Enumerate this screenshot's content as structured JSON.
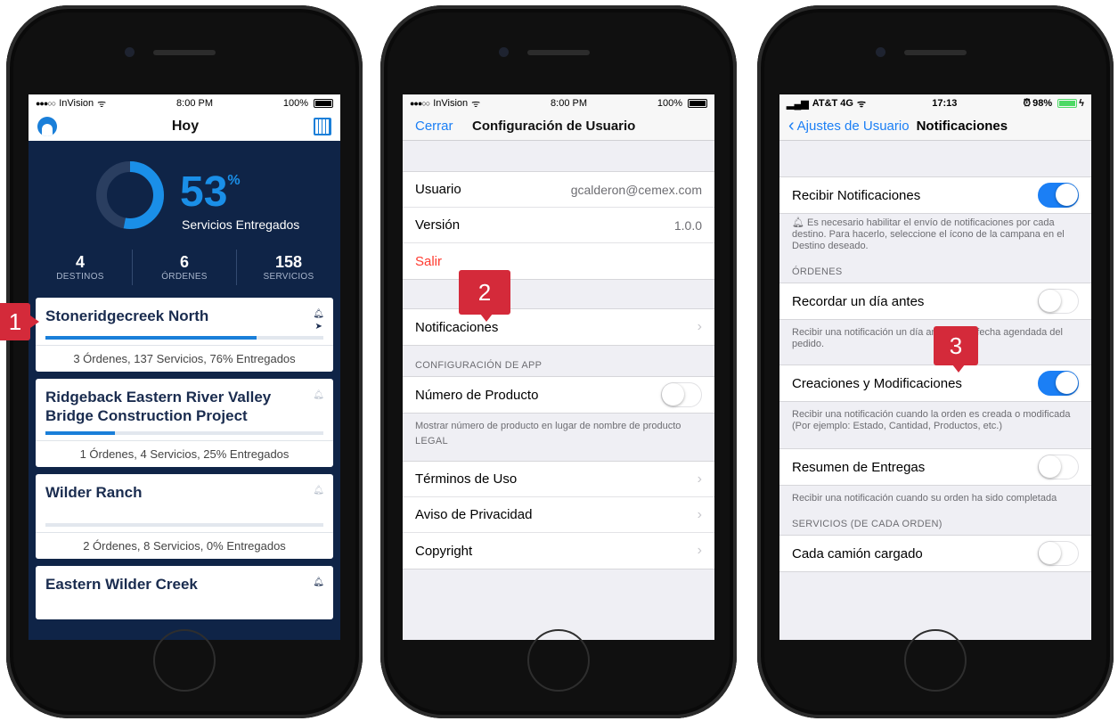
{
  "screen1": {
    "status": {
      "carrier": "InVision",
      "time": "8:00 PM",
      "battery": "100%"
    },
    "nav_title": "Hoy",
    "progress_percent": "53",
    "percent_sign": "%",
    "progress_label": "Servicios Entregados",
    "progress_fraction": 0.53,
    "stats": [
      {
        "value": "4",
        "label": "DESTINOS"
      },
      {
        "value": "6",
        "label": "ÓRDENES"
      },
      {
        "value": "158",
        "label": "SERVICIOS"
      }
    ],
    "cards": [
      {
        "title": "Stoneridgecreek North",
        "summary": "3 Órdenes, 137 Servicios, 76% Entregados",
        "delivered_fraction": 0.76
      },
      {
        "title": "Ridgeback Eastern River Valley Bridge Construction Project",
        "summary": "1 Órdenes, 4 Servicios, 25% Entregados",
        "delivered_fraction": 0.25
      },
      {
        "title": "Wilder Ranch",
        "summary": "2 Órdenes, 8 Servicios, 0% Entregados",
        "delivered_fraction": 0.0
      },
      {
        "title": "Eastern Wilder Creek"
      }
    ]
  },
  "screen2": {
    "status": {
      "carrier": "InVision",
      "time": "8:00 PM",
      "battery": "100%"
    },
    "nav_left": "Cerrar",
    "nav_title": "Configuración de Usuario",
    "user_label": "Usuario",
    "user_value": "gcalderon@cemex.com",
    "version_label": "Versión",
    "version_value": "1.0.0",
    "logout": "Salir",
    "notifications": "Notificaciones",
    "app_section": "CONFIGURACIÓN DE APP",
    "product_number": "Número de Producto",
    "product_note": "Mostrar número de producto en lugar de nombre de producto",
    "legal_section": "LEGAL",
    "terms": "Términos de Uso",
    "privacy": "Aviso de Privacidad",
    "copyright": "Copyright"
  },
  "screen3": {
    "status": {
      "carrier": "AT&T 4G",
      "time": "17:13",
      "battery": "98%"
    },
    "back": "Ajustes de Usuario",
    "nav_title": "Notificaciones",
    "receive": "Recibir Notificaciones",
    "receive_note": "Es necesario habilitar el envío de notificaciones  por cada destino. Para hacerlo, seleccione el ícono de la campana en el Destino deseado.",
    "orders_section": "ÓRDENES",
    "remind": "Recordar un día antes",
    "remind_note": "Recibir una notificación un día antes de la fecha agendada del pedido.",
    "creations": "Creaciones y Modificaciones",
    "creations_note": "Recibir una notificación cuando la orden es creada o modificada (Por ejemplo: Estado, Cantidad, Productos, etc.)",
    "summary": "Resumen de Entregas",
    "summary_note": "Recibir una notificación cuando su orden ha sido completada",
    "services_section": "SERVICIOS (DE CADA ORDEN)",
    "truck": "Cada camión cargado"
  },
  "badges": [
    "1",
    "2",
    "3"
  ],
  "colors": {
    "accent": "#1b7ff5",
    "navy": "#0f2447",
    "badge": "#d42a3a",
    "destructive": "#ff3b30"
  }
}
